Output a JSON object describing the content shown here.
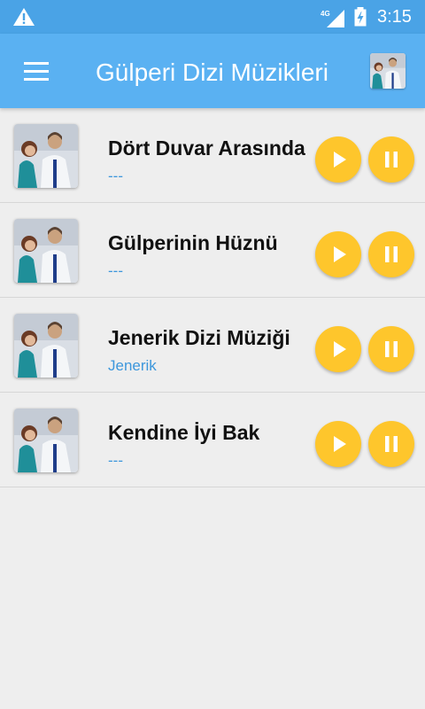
{
  "status_bar": {
    "network": "4G",
    "time": "3:15",
    "icons": [
      "warning-icon",
      "signal-icon",
      "battery-charging-icon"
    ]
  },
  "app_bar": {
    "title": "Gülperi Dizi Müzikleri",
    "menu_icon": "hamburger-menu-icon",
    "avatar_icon": "series-cover-thumbnail"
  },
  "songs": [
    {
      "title": "Dört Duvar Arasında",
      "subtitle": "---"
    },
    {
      "title": "Gülperinin Hüznü",
      "subtitle": "---"
    },
    {
      "title": "Jenerik Dizi Müziği",
      "subtitle": "Jenerik"
    },
    {
      "title": "Kendine İyi Bak",
      "subtitle": "---"
    }
  ],
  "colors": {
    "status_bar": "#4aa3e6",
    "app_bar": "#5ab1f2",
    "button": "#fec62c",
    "subtitle": "#3d97dc"
  }
}
